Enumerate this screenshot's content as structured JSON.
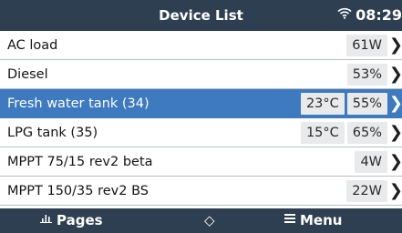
{
  "header": {
    "title": "Device List",
    "time": "08:29",
    "status_icon": "wifi-icon"
  },
  "devices": [
    {
      "name": "AC load",
      "values": [
        "61W"
      ],
      "selected": false
    },
    {
      "name": "Diesel",
      "values": [
        "53%"
      ],
      "selected": false
    },
    {
      "name": "Fresh water tank (34)",
      "values": [
        "23°C",
        "55%"
      ],
      "selected": true
    },
    {
      "name": "LPG tank (35)",
      "values": [
        "15°C",
        "65%"
      ],
      "selected": false
    },
    {
      "name": "MPPT 75/15 rev2 beta",
      "values": [
        "4W"
      ],
      "selected": false
    },
    {
      "name": "MPPT 150/35 rev2 BS",
      "values": [
        "22W"
      ],
      "selected": false
    }
  ],
  "chevron": "❯",
  "footer": {
    "pages_label": "Pages",
    "menu_label": "Menu",
    "updown_glyph": "◇"
  },
  "colors": {
    "bar_bg": "#2d3f50",
    "selected_row": "#3d7ac0",
    "value_box": "#e8eaec"
  }
}
